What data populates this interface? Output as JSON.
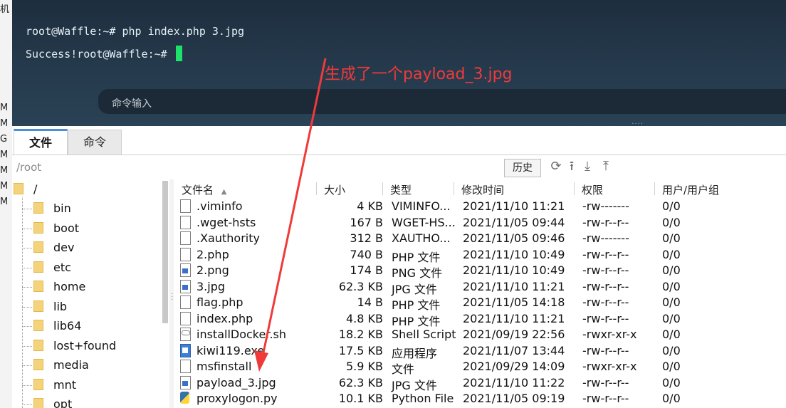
{
  "left_strip": {
    "glyphs": [
      "机",
      "M",
      "M",
      "G",
      "M",
      "M",
      "M",
      "M"
    ]
  },
  "terminal": {
    "lines": [
      "root@Waffle:~# php index.php 3.jpg",
      "Success!root@Waffle:~# "
    ],
    "command_placeholder": "命令输入",
    "dots": "....",
    "cursor_color": "#1ee36a"
  },
  "annotation": {
    "text": "生成了一个payload_3.jpg",
    "color": "#f03a3a"
  },
  "tabs": [
    {
      "label": "文件",
      "active": true
    },
    {
      "label": "命令",
      "active": false
    }
  ],
  "pathbar": {
    "path": "/root",
    "history_label": "历史",
    "icons": [
      "refresh-icon",
      "upload-icon",
      "download-icon",
      "upload-folder-icon"
    ]
  },
  "tree": {
    "root": "/",
    "items": [
      "bin",
      "boot",
      "dev",
      "etc",
      "home",
      "lib",
      "lib64",
      "lost+found",
      "media",
      "mnt",
      "opt"
    ]
  },
  "file_table": {
    "columns": [
      "文件名",
      "大小",
      "类型",
      "修改时间",
      "权限",
      "用户/用户组"
    ],
    "sort_indicator": "▲",
    "rows": [
      {
        "name": ".viminfo",
        "size": "4 KB",
        "type": "VIMINFO...",
        "modified": "2021/11/10 11:21",
        "perm": "-rw-------",
        "owner": "0/0",
        "icon": "file-icon"
      },
      {
        "name": ".wget-hsts",
        "size": "167 B",
        "type": "WGET-HS...",
        "modified": "2021/11/05 09:44",
        "perm": "-rw-r--r--",
        "owner": "0/0",
        "icon": "file-icon"
      },
      {
        "name": ".Xauthority",
        "size": "312 B",
        "type": "XAUTHO...",
        "modified": "2021/11/05 09:46",
        "perm": "-rw-------",
        "owner": "0/0",
        "icon": "file-icon"
      },
      {
        "name": "2.php",
        "size": "740 B",
        "type": "PHP 文件",
        "modified": "2021/11/10 10:49",
        "perm": "-rw-r--r--",
        "owner": "0/0",
        "icon": "file-icon"
      },
      {
        "name": "2.png",
        "size": "174 B",
        "type": "PNG 文件",
        "modified": "2021/11/10 10:49",
        "perm": "-rw-r--r--",
        "owner": "0/0",
        "icon": "image-file-icon"
      },
      {
        "name": "3.jpg",
        "size": "62.3 KB",
        "type": "JPG 文件",
        "modified": "2021/11/10 11:21",
        "perm": "-rw-r--r--",
        "owner": "0/0",
        "icon": "image-file-icon"
      },
      {
        "name": "flag.php",
        "size": "14 B",
        "type": "PHP 文件",
        "modified": "2021/11/05 14:18",
        "perm": "-rw-r--r--",
        "owner": "0/0",
        "icon": "file-icon"
      },
      {
        "name": "index.php",
        "size": "4.8 KB",
        "type": "PHP 文件",
        "modified": "2021/11/10 11:21",
        "perm": "-rw-r--r--",
        "owner": "0/0",
        "icon": "file-icon"
      },
      {
        "name": "installDocker.sh",
        "size": "18.2 KB",
        "type": "Shell Script",
        "modified": "2021/09/19 22:56",
        "perm": "-rwxr-xr-x",
        "owner": "0/0",
        "icon": "shell-script-icon"
      },
      {
        "name": "kiwi119.exe",
        "size": "17.5 KB",
        "type": "应用程序",
        "modified": "2021/11/07 13:44",
        "perm": "-rw-r--r--",
        "owner": "0/0",
        "icon": "exe-file-icon"
      },
      {
        "name": "msfinstall",
        "size": "5.9 KB",
        "type": "文件",
        "modified": "2021/09/29 14:09",
        "perm": "-rwxr-xr-x",
        "owner": "0/0",
        "icon": "file-icon"
      },
      {
        "name": "payload_3.jpg",
        "size": "62.3 KB",
        "type": "JPG 文件",
        "modified": "2021/11/10 11:22",
        "perm": "-rw-r--r--",
        "owner": "0/0",
        "icon": "image-file-icon"
      },
      {
        "name": "proxylogon.py",
        "size": "10.1 KB",
        "type": "Python File",
        "modified": "2021/11/05 09:19",
        "perm": "-rw-r--r--",
        "owner": "0/0",
        "icon": "python-file-icon"
      }
    ]
  }
}
